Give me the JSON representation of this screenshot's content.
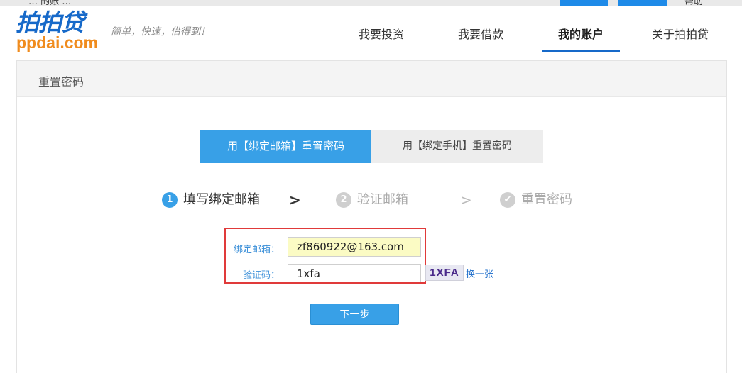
{
  "topbar": {
    "partial_left_text": "… 的账 …",
    "partial_right_text": "帮助"
  },
  "header": {
    "logo_cn": "拍拍贷",
    "logo_en": "ppdai.com",
    "slogan": "简单，快速，借得到！",
    "nav": [
      "我要投资",
      "我要借款",
      "我的账户",
      "关于拍拍贷"
    ],
    "active_nav": "我的账户"
  },
  "panel": {
    "title": "重置密码"
  },
  "tabs": [
    {
      "label": "用【绑定邮箱】重置密码",
      "active": true
    },
    {
      "label": "用【绑定手机】重置密码",
      "active": false
    }
  ],
  "steps": [
    {
      "num": "1",
      "label": "填写绑定邮箱",
      "state": "active"
    },
    {
      "num": "2",
      "label": "验证邮箱",
      "state": "inactive"
    },
    {
      "num": "✔",
      "label": "重置密码",
      "state": "inactive"
    }
  ],
  "form": {
    "email_label": "绑定邮箱：",
    "email_value": "zf860922@163.com",
    "captcha_label": "验证码：",
    "captcha_value": "1xfa",
    "captcha_image_text": "1XFA",
    "change_link": "换一张",
    "next_button": "下一步"
  },
  "colors": {
    "brand_blue": "#1669c9",
    "accent_blue": "#38a0e7",
    "brand_orange": "#f08c1e",
    "highlight_red": "#e03a3a",
    "autofill_yellow": "#fbfbc4"
  }
}
